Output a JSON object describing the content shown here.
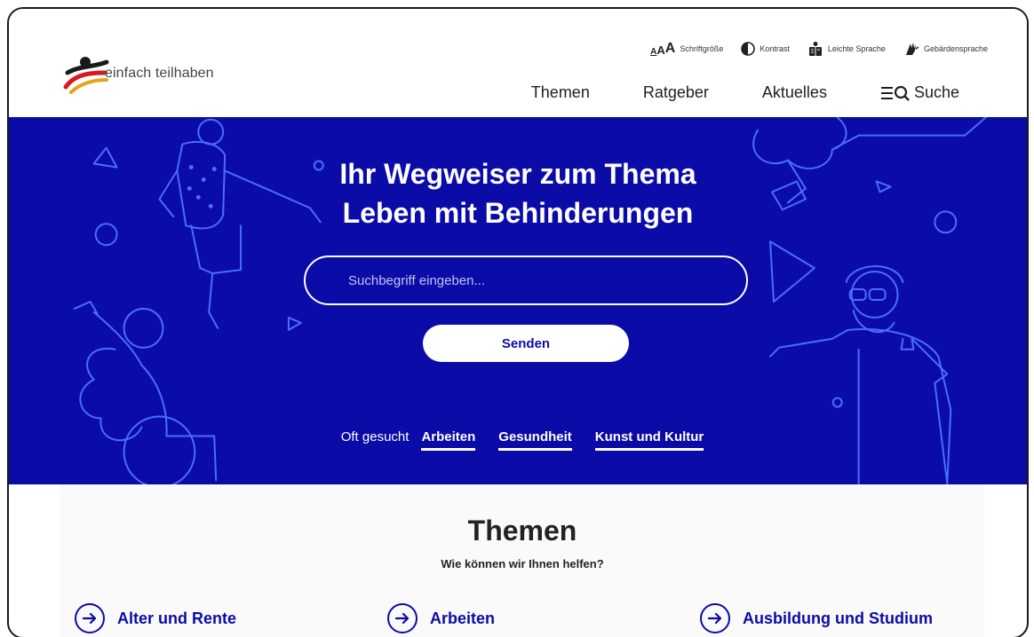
{
  "site": {
    "logo_text": "einfach teilhaben"
  },
  "utility": {
    "font_size": {
      "glyphs": [
        "A",
        "A",
        "A"
      ],
      "label": "Schriftgröße"
    },
    "contrast": "Kontrast",
    "easy_language": "Leichte Sprache",
    "sign_language": "Gebärdensprache"
  },
  "nav": {
    "themes": "Themen",
    "guide": "Ratgeber",
    "news": "Aktuelles",
    "search": "Suche"
  },
  "hero": {
    "title_line1": "Ihr Wegweiser zum Thema",
    "title_line2": "Leben mit Behinderungen",
    "search_placeholder": "Suchbegriff eingeben...",
    "submit": "Senden",
    "popular_label": "Oft gesucht",
    "popular_links": [
      "Arbeiten",
      "Gesundheit",
      "Kunst und Kultur"
    ]
  },
  "topics": {
    "title": "Themen",
    "subtitle": "Wie können wir Ihnen helfen?",
    "items": [
      "Alter und Rente",
      "Arbeiten",
      "Ausbildung und Studium"
    ]
  },
  "colors": {
    "brand_blue": "#0b0ba8",
    "accent_red": "#d71920",
    "accent_gold": "#e8a21a"
  }
}
